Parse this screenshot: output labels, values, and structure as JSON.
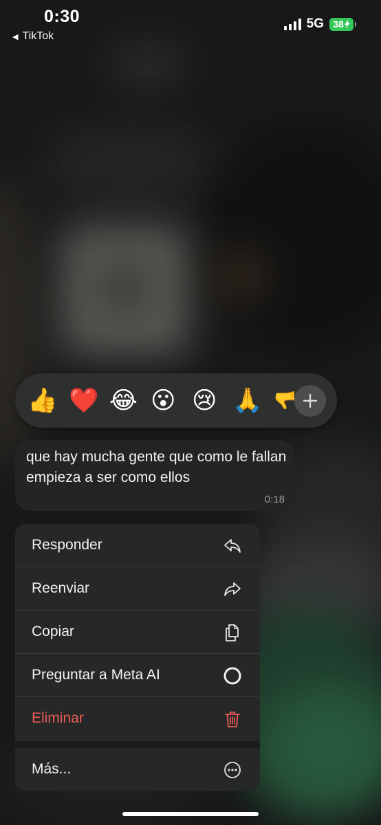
{
  "status_bar": {
    "time": "0:30",
    "back_app": "TikTok",
    "network": "5G",
    "battery": "38",
    "icons": [
      "cellular-signal-icon",
      "battery-charging-icon"
    ]
  },
  "reactions": {
    "emojis": [
      "👍",
      "❤️",
      "😂",
      "😮",
      "😢",
      "🙏",
      "🫳"
    ],
    "more_icon": "plus-icon"
  },
  "message": {
    "text": "que hay mucha gente que como le fallan empieza a ser como ellos",
    "time": "0:18"
  },
  "menu": {
    "items": [
      {
        "label": "Responder",
        "icon": "reply-icon"
      },
      {
        "label": "Reenviar",
        "icon": "forward-icon"
      },
      {
        "label": "Copiar",
        "icon": "copy-icon"
      },
      {
        "label": "Preguntar a Meta AI",
        "icon": "meta-ai-icon"
      },
      {
        "label": "Eliminar",
        "icon": "trash-icon",
        "color": "#eb5b57"
      },
      {
        "label": "Más...",
        "icon": "more-icon"
      }
    ]
  },
  "colors": {
    "accent_green": "#34c759",
    "danger": "#eb5b57",
    "menu_bg": "#262827"
  }
}
